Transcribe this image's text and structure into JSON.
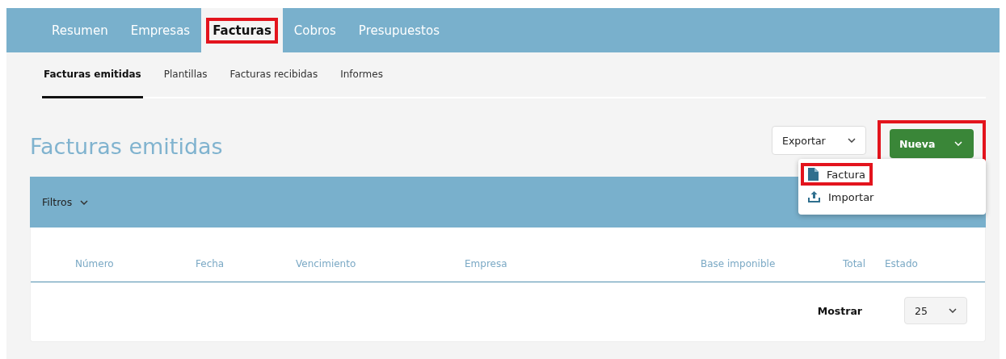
{
  "top_nav": [
    {
      "label": "Resumen",
      "selected": false,
      "highlighted": false
    },
    {
      "label": "Empresas",
      "selected": false,
      "highlighted": false
    },
    {
      "label": "Facturas",
      "selected": true,
      "highlighted": true
    },
    {
      "label": "Cobros",
      "selected": false,
      "highlighted": false
    },
    {
      "label": "Presupuestos",
      "selected": false,
      "highlighted": false
    }
  ],
  "sub_nav": [
    {
      "label": "Facturas emitidas",
      "selected": true
    },
    {
      "label": "Plantillas",
      "selected": false
    },
    {
      "label": "Facturas recibidas",
      "selected": false
    },
    {
      "label": "Informes",
      "selected": false
    }
  ],
  "title": "Facturas emitidas",
  "export_button": {
    "label": "Exportar"
  },
  "new_button": {
    "label": "Nueva",
    "highlighted": true,
    "expanded": true
  },
  "new_menu": [
    {
      "kind": "file",
      "label": "Factura",
      "highlighted": true
    },
    {
      "kind": "upload",
      "label": "Importar",
      "highlighted": false
    }
  ],
  "filters": {
    "label": "Filtros"
  },
  "table": {
    "columns": [
      {
        "label": "Número"
      },
      {
        "label": "Fecha"
      },
      {
        "label": "Vencimiento"
      },
      {
        "label": "Empresa"
      },
      {
        "label": "Base imponible"
      },
      {
        "label": "Total"
      },
      {
        "label": "Estado"
      }
    ]
  },
  "pagination": {
    "label": "Mostrar",
    "page_size": "25"
  }
}
